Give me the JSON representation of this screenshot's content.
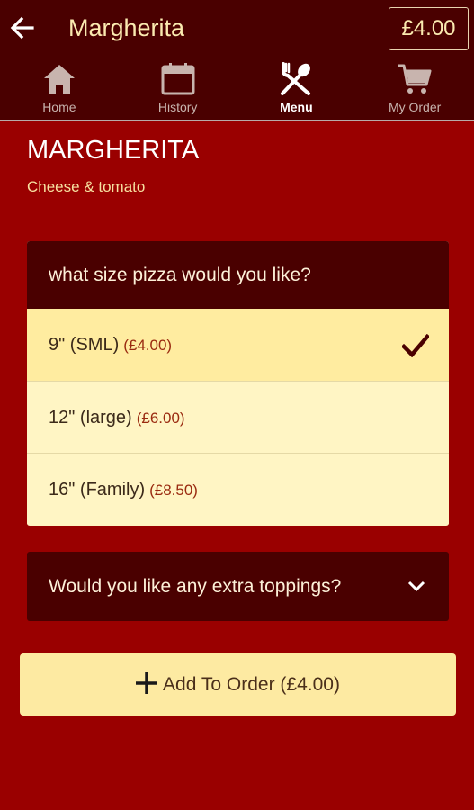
{
  "header": {
    "title": "Margherita",
    "order_total": "£4.00",
    "back_icon": "arrow-left-icon"
  },
  "tabs": [
    {
      "label": "Home",
      "icon": "home-icon",
      "active": false
    },
    {
      "label": "History",
      "icon": "calendar-icon",
      "active": false
    },
    {
      "label": "Menu",
      "icon": "fork-spoon-icon",
      "active": true
    },
    {
      "label": "My Order",
      "icon": "cart-icon",
      "active": false
    }
  ],
  "item": {
    "name": "MARGHERITA",
    "description": "Cheese & tomato"
  },
  "size_section": {
    "question": "what size pizza would you like?",
    "options": [
      {
        "label": "9\" (SML)",
        "price": "(£4.00)",
        "selected": true
      },
      {
        "label": "12\" (large)",
        "price": "(£6.00)",
        "selected": false
      },
      {
        "label": "16\" (Family)",
        "price": "(£8.50)",
        "selected": false
      }
    ]
  },
  "toppings_section": {
    "question": "Would you like any extra toppings?",
    "expanded": false
  },
  "add_button": {
    "label": "Add To Order (£4.00)"
  },
  "colors": {
    "background": "#9a0000",
    "header": "#4a0000",
    "option_bg": "#fff5c4",
    "selected_bg": "#ffeca0",
    "accent_text": "#fbeab0"
  }
}
